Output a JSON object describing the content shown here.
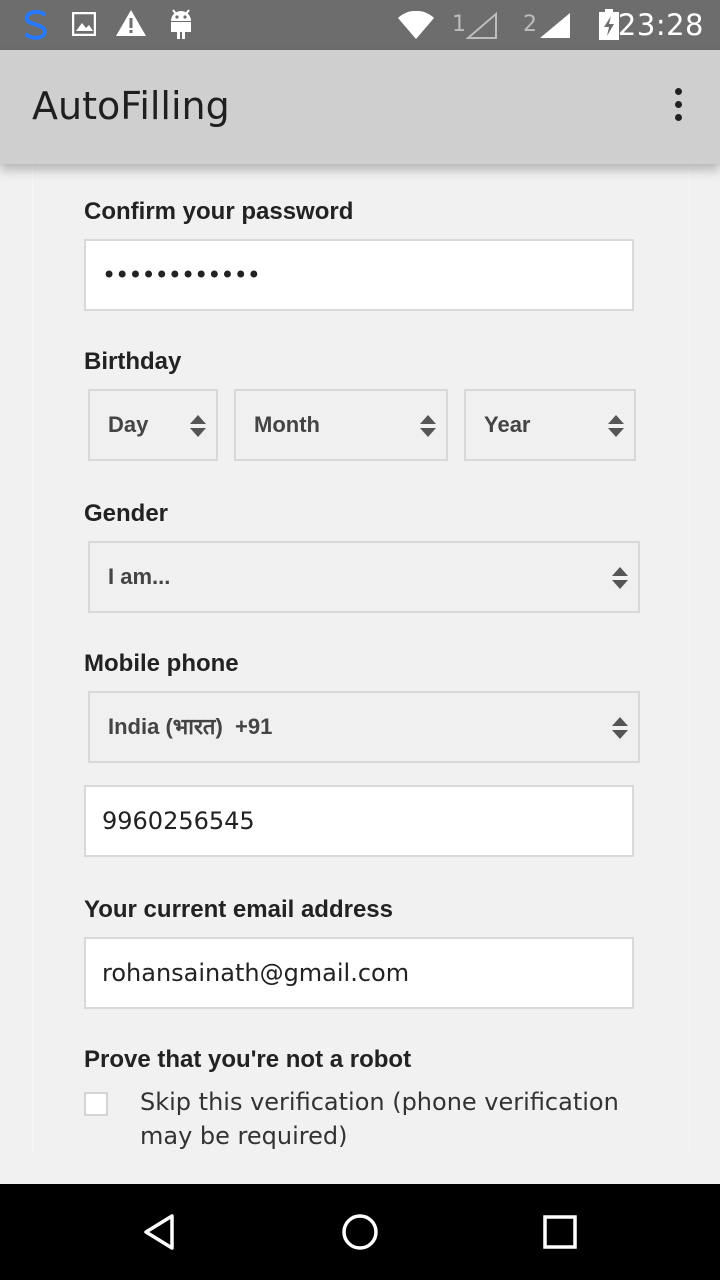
{
  "status_bar": {
    "time": "23:28",
    "sim1_label": "1",
    "sim2_label": "2",
    "icons": [
      "sync-icon",
      "image-icon",
      "warning-icon",
      "android-icon",
      "wifi-icon",
      "signal-icon",
      "battery-charging-icon"
    ]
  },
  "app_bar": {
    "title": "AutoFilling",
    "overflow_icon": "more-vert-icon"
  },
  "form": {
    "confirm_password": {
      "label": "Confirm your password",
      "value": "••••••••••••"
    },
    "birthday": {
      "label": "Birthday",
      "day": "Day",
      "month": "Month",
      "year": "Year"
    },
    "gender": {
      "label": "Gender",
      "value": "I am..."
    },
    "mobile_phone": {
      "label": "Mobile phone",
      "country": "India (भारत)  +91",
      "number": "9960256545"
    },
    "email": {
      "label": "Your current email address",
      "value": "rohansainath@gmail.com"
    },
    "robot": {
      "label": "Prove that you're not a robot",
      "skip_label": "Skip this verification (phone verification may be required)",
      "checked": false
    }
  },
  "nav_bar": {
    "icons": [
      "back-icon",
      "home-icon",
      "recents-icon"
    ]
  }
}
